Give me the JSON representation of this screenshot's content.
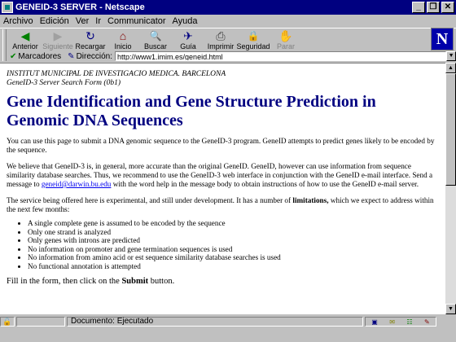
{
  "window": {
    "title": "GENEID-3 SERVER - Netscape",
    "buttons": [
      "_",
      "❐",
      "✕"
    ]
  },
  "menu": [
    "Archivo",
    "Edición",
    "Ver",
    "Ir",
    "Communicator",
    "Ayuda"
  ],
  "toolbar": [
    {
      "label": "Anterior",
      "icon": "back-arrow-icon",
      "glyph": "◀",
      "enabled": true
    },
    {
      "label": "Siguiente",
      "icon": "forward-arrow-icon",
      "glyph": "▶",
      "enabled": false
    },
    {
      "label": "Recargar",
      "icon": "reload-icon",
      "glyph": "↻",
      "enabled": true
    },
    {
      "label": "Inicio",
      "icon": "home-icon",
      "glyph": "⌂",
      "enabled": true
    },
    {
      "label": "Buscar",
      "icon": "search-icon",
      "glyph": "🔍",
      "enabled": true
    },
    {
      "label": "Guía",
      "icon": "guide-icon",
      "glyph": "✈",
      "enabled": true
    },
    {
      "label": "Imprimir",
      "icon": "print-icon",
      "glyph": "⎙",
      "enabled": true
    },
    {
      "label": "Seguridad",
      "icon": "security-icon",
      "glyph": "🔒",
      "enabled": true
    },
    {
      "label": "Parar",
      "icon": "stop-icon",
      "glyph": "✋",
      "enabled": false
    }
  ],
  "logo": "N",
  "location": {
    "bookmarks_label": "Marcadores",
    "address_label": "Dirección:",
    "url": "http://www1.imim.es/geneid.html"
  },
  "page": {
    "institute": "INSTITUT MUNICIPAL DE INVESTIGACIO MEDICA. BARCELONA",
    "form_name": "GeneID-3 Server Search Form (0b1)",
    "heading": "Gene Identification and Gene Structure Prediction in Genomic DNA Sequences",
    "para1": "You can use this page to submit a DNA genomic sequence to the GeneID-3 program. GeneID attempts to predict genes likely to be encoded by the sequence.",
    "para2_before": "We believe that GeneID-3 is, in general, more accurate than the original GeneID. GeneID, however can use information from sequence similarity database searches. Thus, we recommend to use the GeneID-3 web interface in conjunction with the GeneID e-mail interface. Send a message to ",
    "para2_link": "geneid@darwin.bu.edu",
    "para2_after": " with the word help in the message body to obtain instructions of how to use the GeneID e-mail server.",
    "para3_before": "The service being offered here is experimental, and still under development. It has a number of ",
    "para3_bold": "limitations,",
    "para3_after": " which we expect to address within the next few months:",
    "limitations": [
      "A single complete gene is assumed to be encoded by the sequence",
      "Only one strand is analyzed",
      "Only genes with introns are predicted",
      "No information on promoter and gene termination sequences is used",
      "No information from amino acid or est sequence similarity database searches is used",
      "No functional annotation is attempted"
    ],
    "fill_before": "Fill in the form, then click on the ",
    "fill_bold": "Submit",
    "fill_after": " button."
  },
  "status": {
    "text": "Documento: Ejecutado"
  }
}
